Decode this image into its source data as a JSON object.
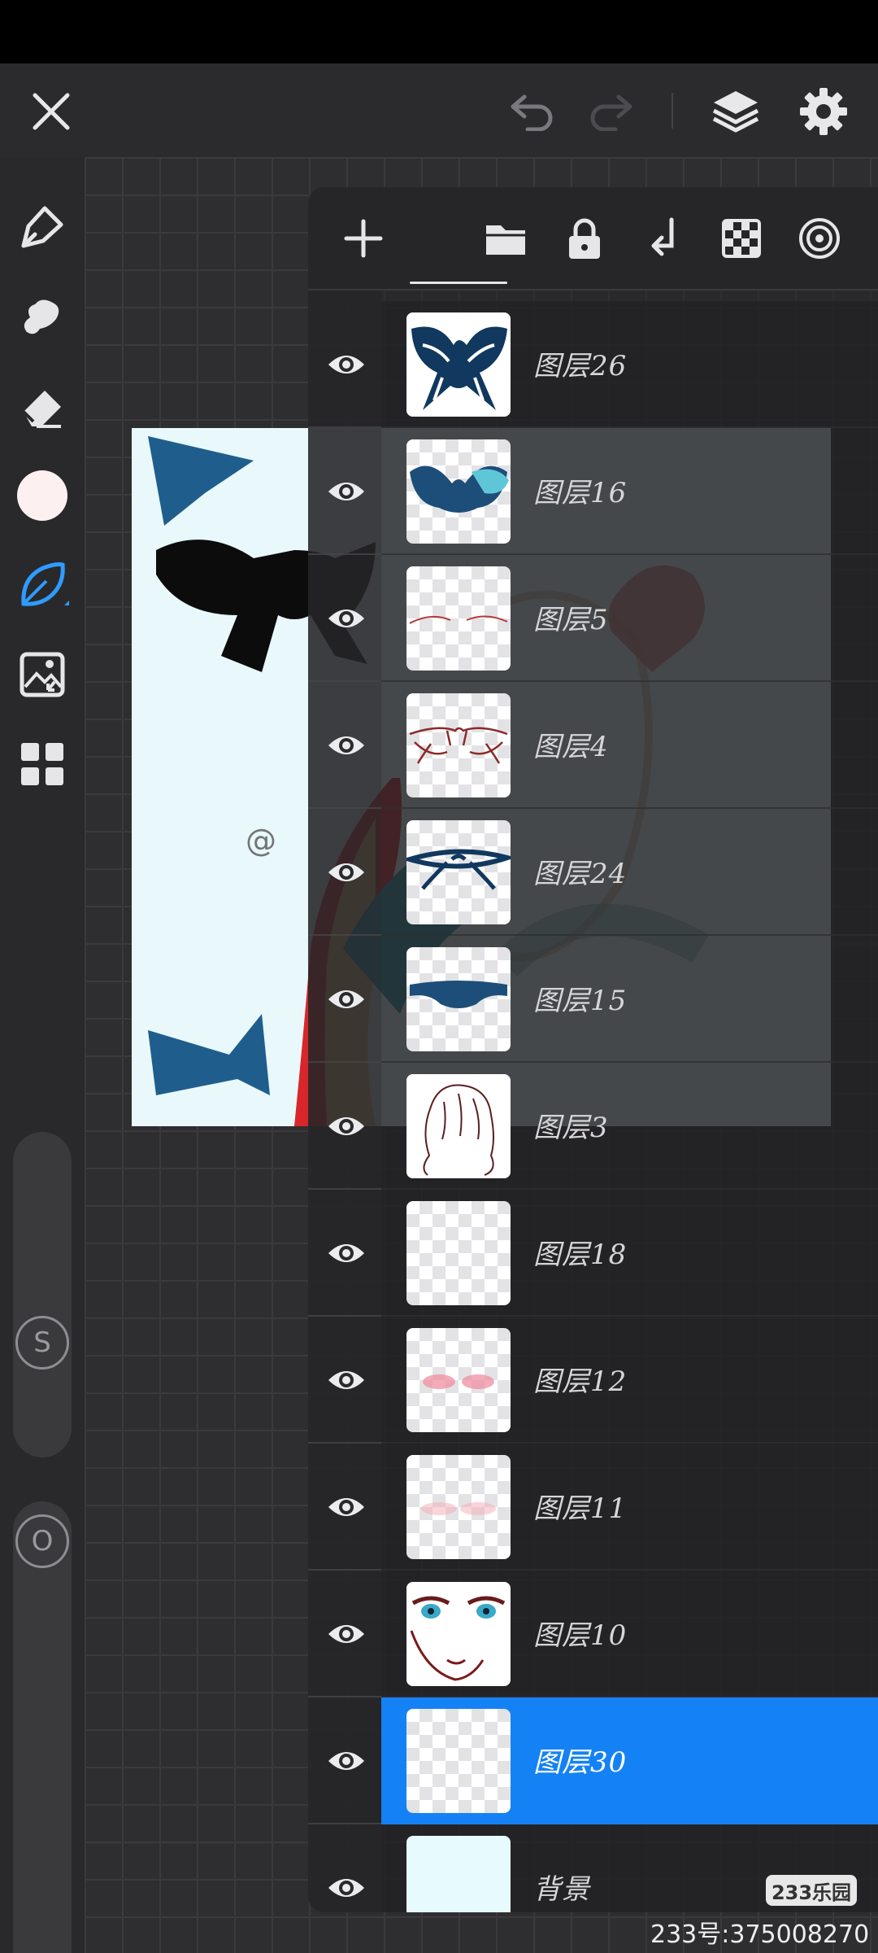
{
  "toolbar_icons": {
    "close": "close-icon",
    "undo": "undo-icon",
    "redo": "redo-icon",
    "layers": "layers-icon",
    "settings": "gear-icon"
  },
  "left_tools": [
    "pen-tool-icon",
    "smudge-icon",
    "eraser-icon",
    "color-swatch",
    "brush-leaf-icon",
    "import-image-icon",
    "gallery-grid-icon"
  ],
  "sliders": {
    "size_label": "S",
    "opacity_label": "O"
  },
  "panel_actions": [
    "add-layer-icon",
    "folder-icon",
    "lock-icon",
    "merge-down-icon",
    "transparency-icon",
    "blend-mode-icon"
  ],
  "layers": [
    {
      "name": "图层26",
      "thumb": "bow-dark"
    },
    {
      "name": "图层16",
      "thumb": "bow-blue"
    },
    {
      "name": "图层5",
      "thumb": "lines-light"
    },
    {
      "name": "图层4",
      "thumb": "lines-red"
    },
    {
      "name": "图层24",
      "thumb": "ribbon"
    },
    {
      "name": "图层15",
      "thumb": "band"
    },
    {
      "name": "图层3",
      "thumb": "hair-sketch"
    },
    {
      "name": "图层18",
      "thumb": "empty"
    },
    {
      "name": "图层12",
      "thumb": "blush"
    },
    {
      "name": "图层11",
      "thumb": "blush-light"
    },
    {
      "name": "图层10",
      "thumb": "face"
    },
    {
      "name": "图层30",
      "thumb": "empty",
      "selected": true
    },
    {
      "name": "背景",
      "thumb": "background"
    }
  ],
  "colors": {
    "selected_layer": "#1482f5",
    "accent_tool": "#2e9cff",
    "artwork_background": "#e8f8fb"
  },
  "watermark": {
    "logo": "233乐园",
    "text": "233号:375008270"
  }
}
